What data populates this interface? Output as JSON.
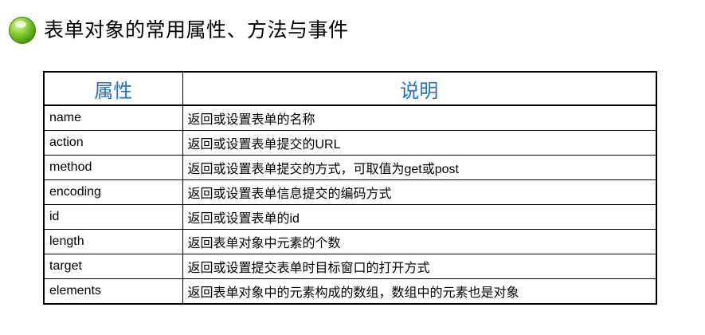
{
  "header": {
    "title": "表单对象的常用属性、方法与事件",
    "bullet_color": "#5cb617"
  },
  "table": {
    "columns": [
      "属性",
      "说明"
    ],
    "header_color": "#1f6fd8",
    "rows": [
      {
        "name": "name",
        "desc": "返回或设置表单的名称"
      },
      {
        "name": "action",
        "desc": "返回或设置表单提交的URL"
      },
      {
        "name": "method",
        "desc": "返回或设置表单提交的方式，可取值为get或post"
      },
      {
        "name": "encoding",
        "desc": "返回或设置表单信息提交的编码方式"
      },
      {
        "name": "id",
        "desc": "返回或设置表单的id"
      },
      {
        "name": "length",
        "desc": "返回表单对象中元素的个数"
      },
      {
        "name": "target",
        "desc": "返回或设置提交表单时目标窗口的打开方式"
      },
      {
        "name": "elements",
        "desc": "返回表单对象中的元素构成的数组，数组中的元素也是对象"
      }
    ]
  }
}
